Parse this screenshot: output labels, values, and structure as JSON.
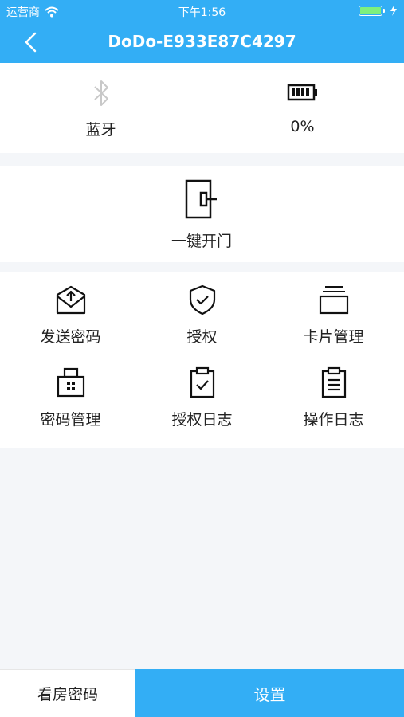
{
  "status_bar": {
    "carrier": "运营商",
    "time": "下午1:56"
  },
  "header": {
    "title": "DoDo-E933E87C4297",
    "back_icon": "chevron-left-icon"
  },
  "device_status": {
    "bluetooth": {
      "label": "蓝牙",
      "icon": "bluetooth-icon"
    },
    "battery": {
      "label": "0%",
      "icon": "battery-icon"
    }
  },
  "unlock": {
    "label": "一键开门",
    "icon": "door-icon"
  },
  "features": [
    {
      "label": "发送密码",
      "icon": "send-mail-icon"
    },
    {
      "label": "授权",
      "icon": "shield-check-icon"
    },
    {
      "label": "卡片管理",
      "icon": "cards-icon"
    },
    {
      "label": "密码管理",
      "icon": "keypad-lock-icon"
    },
    {
      "label": "授权日志",
      "icon": "clipboard-check-icon"
    },
    {
      "label": "操作日志",
      "icon": "clipboard-list-icon"
    }
  ],
  "bottom_bar": {
    "left_label": "看房密码",
    "right_label": "设置"
  },
  "colors": {
    "primary": "#33aef5",
    "background": "#f4f6f9",
    "card": "#ffffff",
    "battery_fill": "#7ef07e"
  }
}
